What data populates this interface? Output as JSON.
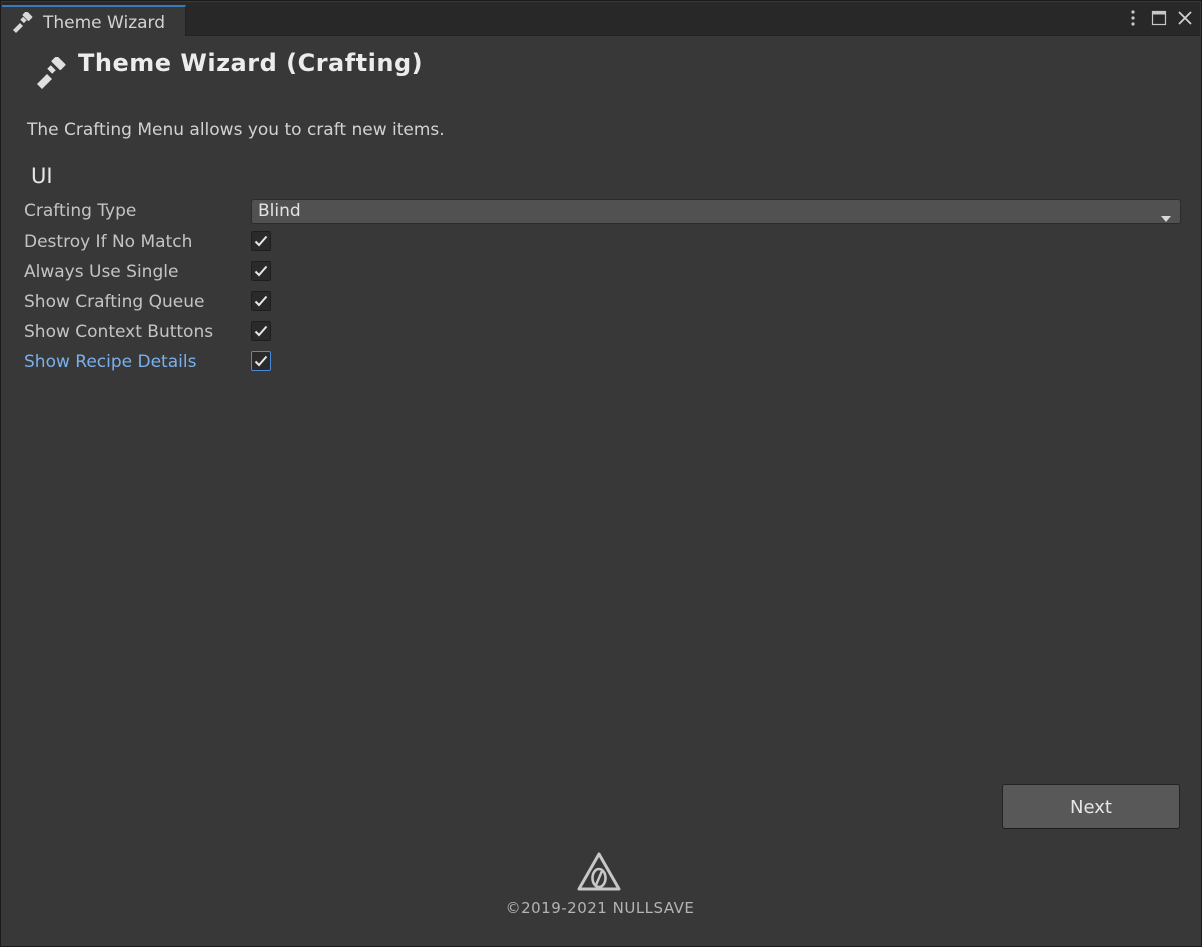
{
  "window": {
    "tab_title": "Theme Wizard",
    "controls": [
      "more-options-icon",
      "maximize-icon",
      "close-icon"
    ]
  },
  "header": {
    "title": "Theme Wizard (Crafting)",
    "icon": "paintbrush-icon"
  },
  "description": "The Crafting Menu allows you to craft new items.",
  "section": {
    "title": "UI"
  },
  "fields": {
    "crafting_type": {
      "label": "Crafting Type",
      "value": "Blind"
    },
    "destroy_if_no_match": {
      "label": "Destroy If No Match",
      "checked": true
    },
    "always_use_single": {
      "label": "Always Use Single",
      "checked": true
    },
    "show_crafting_queue": {
      "label": "Show Crafting Queue",
      "checked": true
    },
    "show_context_buttons": {
      "label": "Show Context Buttons",
      "checked": true
    },
    "show_recipe_details": {
      "label": "Show Recipe Details",
      "checked": true,
      "focused": true
    }
  },
  "buttons": {
    "next_label": "Next"
  },
  "footer": {
    "logo": "nullsave-logo-icon",
    "copyright": "©2019-2021 NULLSAVE"
  },
  "colors": {
    "background": "#383838",
    "tab_accent": "#3a79bb",
    "focus_label": "#7ab0ee"
  }
}
